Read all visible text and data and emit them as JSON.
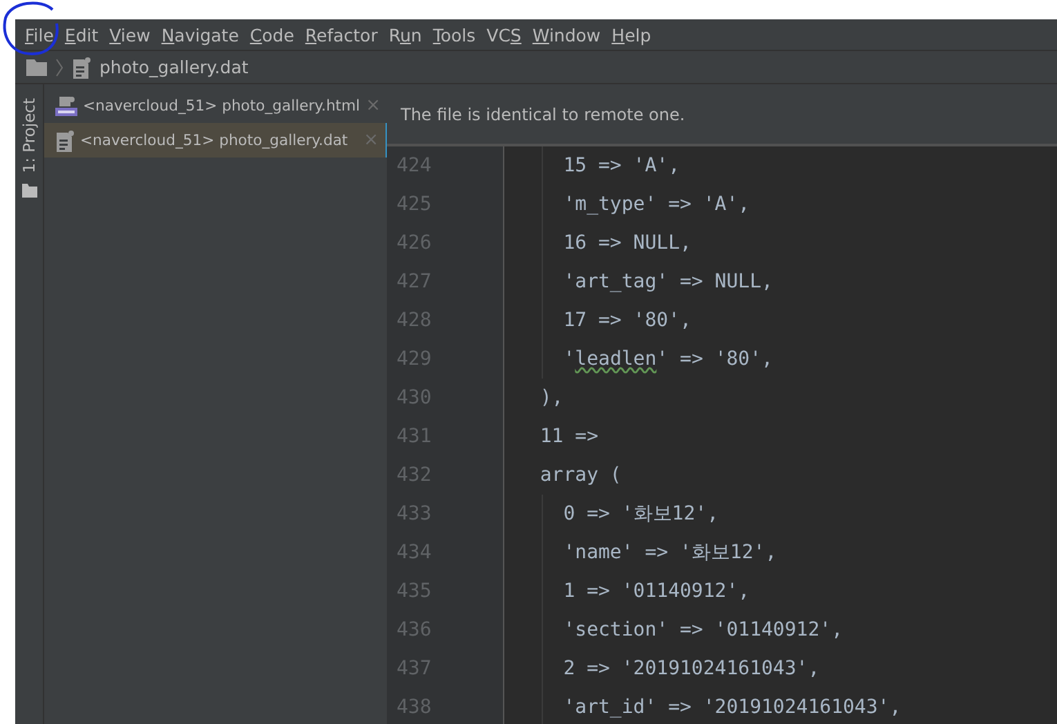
{
  "menu": [
    {
      "parts": [
        {
          "text": "F",
          "underline": true
        },
        {
          "text": "ile",
          "underline": false
        }
      ]
    },
    {
      "parts": [
        {
          "text": "E",
          "underline": true
        },
        {
          "text": "dit",
          "underline": false
        }
      ]
    },
    {
      "parts": [
        {
          "text": "V",
          "underline": true
        },
        {
          "text": "iew",
          "underline": false
        }
      ]
    },
    {
      "parts": [
        {
          "text": "N",
          "underline": true
        },
        {
          "text": "avigate",
          "underline": false
        }
      ]
    },
    {
      "parts": [
        {
          "text": "C",
          "underline": true
        },
        {
          "text": "ode",
          "underline": false
        }
      ]
    },
    {
      "parts": [
        {
          "text": "R",
          "underline": true
        },
        {
          "text": "efactor",
          "underline": false
        }
      ]
    },
    {
      "parts": [
        {
          "text": "R",
          "underline": false
        },
        {
          "text": "u",
          "underline": true
        },
        {
          "text": "n",
          "underline": false
        }
      ]
    },
    {
      "parts": [
        {
          "text": "T",
          "underline": true
        },
        {
          "text": "ools",
          "underline": false
        }
      ]
    },
    {
      "parts": [
        {
          "text": "VC",
          "underline": false
        },
        {
          "text": "S",
          "underline": true
        }
      ]
    },
    {
      "parts": [
        {
          "text": "W",
          "underline": true
        },
        {
          "text": "indow",
          "underline": false
        }
      ]
    },
    {
      "parts": [
        {
          "text": "H",
          "underline": true
        },
        {
          "text": "elp",
          "underline": false
        }
      ]
    }
  ],
  "breadcrumb": {
    "file": "photo_gallery.dat"
  },
  "tool_strip": {
    "label": "1: Project"
  },
  "open_files": [
    {
      "kind": "php",
      "label": "<navercloud_51> photo_gallery.html",
      "close": "×",
      "selected": false
    },
    {
      "kind": "text",
      "label": "<navercloud_51> photo_gallery.dat",
      "close": "×",
      "selected": true
    }
  ],
  "editor": {
    "notice": "The file is identical to remote one.",
    "lines": [
      {
        "number": "424",
        "text": "    15 => 'A',"
      },
      {
        "number": "425",
        "text": "    'm_type' => 'A',"
      },
      {
        "number": "426",
        "text": "    16 => NULL,"
      },
      {
        "number": "427",
        "text": "    'art_tag' => NULL,"
      },
      {
        "number": "428",
        "text": "    17 => '80',"
      },
      {
        "number": "429",
        "parts": [
          {
            "text": "    '",
            "typo": false
          },
          {
            "text": "leadlen",
            "typo": true
          },
          {
            "text": "' => '80',",
            "typo": false
          }
        ]
      },
      {
        "number": "430",
        "text": "  ),"
      },
      {
        "number": "431",
        "text": "  11 =>"
      },
      {
        "number": "432",
        "text": "  array ("
      },
      {
        "number": "433",
        "text": "    0 => '화보12',"
      },
      {
        "number": "434",
        "text": "    'name' => '화보12',"
      },
      {
        "number": "435",
        "text": "    1 => '01140912',"
      },
      {
        "number": "436",
        "text": "    'section' => '01140912',"
      },
      {
        "number": "437",
        "text": "    2 => '20191024161043',"
      },
      {
        "number": "438",
        "text": "    'art_id' => '20191024161043',"
      }
    ]
  }
}
